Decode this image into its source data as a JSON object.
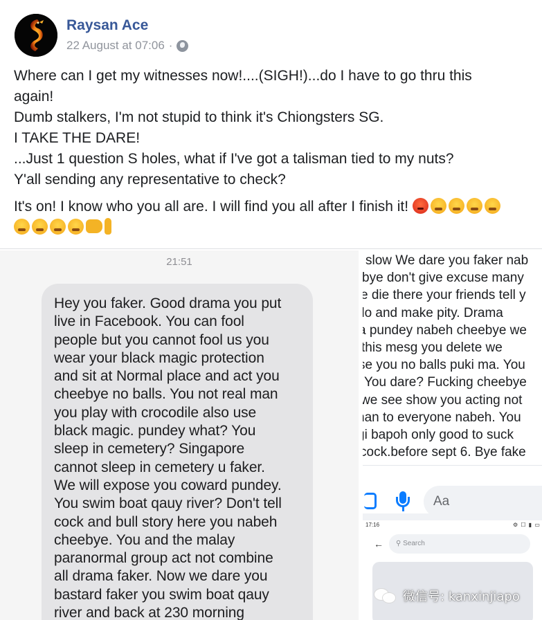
{
  "post": {
    "author": "Raysan Ace",
    "timestamp": "22 August at 07:06",
    "meta_separator": "·",
    "audience_icon": "globe-icon",
    "lines": [
      "Where can I get my witnesses now!....(SIGH!)...do I have to go thru this",
      "again!",
      "Dumb stalkers, I'm not stupid to think it's Chiongsters SG.",
      "I TAKE THE DARE!",
      "...Just 1 question S holes, what if I've got a talisman tied to my nuts?",
      "Y'all sending any representative to check?"
    ],
    "closing_line": "It's on! I know who you all are. I will find you all after I finish it!",
    "emojis_line1": [
      "angry-face",
      "face-with-steam",
      "face-with-steam",
      "face-with-steam",
      "face-with-steam"
    ],
    "emojis_line2": [
      "face-with-steam",
      "face-with-steam",
      "face-with-steam",
      "face-with-steam",
      "fist",
      "middle-finger"
    ]
  },
  "left_screenshot": {
    "time": "21:51",
    "message_lines": [
      "Hey you faker. Good drama you put",
      "live in Facebook. You can fool",
      "people but you cannot fool us you",
      "wear your black magic protection",
      "and sit at Normal place and act you",
      "cheebye no balls. You not real man",
      "you play with crocodile also use",
      "black magic. pundey what? You",
      "sleep in cemetery? Singapore",
      "cannot sleep in cemetery u faker.",
      "We will expose you coward pundey.",
      "You swim boat qauy river? Don't tell",
      "cock and bull story here you nabeh",
      "cheebye. You and the malay",
      "paranormal group act not combine",
      "all drama faker. Now we dare you",
      "bastard faker you swim boat qauy",
      "river and back at 230 morning"
    ]
  },
  "right_screenshot": {
    "message_lines": [
      "slow We dare you faker nab",
      "bye don't give excuse many",
      "e die there your friends tell y",
      "do and make pity. Drama",
      "a pundey nabeh cheebye we",
      "this mesg you delete we",
      "se you no balls puki ma. You",
      "You dare? Fucking cheebye",
      "we see show you acting not",
      "nan to everyone nabeh. You",
      "gi bapoh only good to suck",
      "cock.before sept 6. Bye fake"
    ],
    "composer_placeholder": "Aa",
    "mini_time": "17:16",
    "mini_status_icons": "⚙ ☐ ▮ ▭",
    "mini_back": "←",
    "mini_search_placeholder": "Search",
    "accent_color": "#0a7cff"
  },
  "watermark": {
    "text": "微信号: kanxinjiapo"
  }
}
